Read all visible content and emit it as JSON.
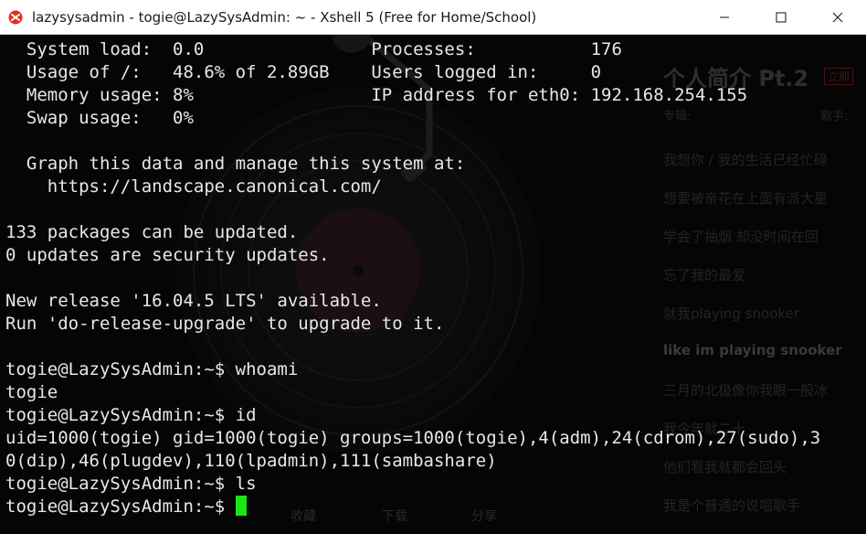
{
  "window": {
    "title": "lazysysadmin - togie@LazySysAdmin: ~ - Xshell 5 (Free for Home/School)",
    "controls": [
      "minimize-icon",
      "maximize-icon",
      "close-icon"
    ]
  },
  "terminal": {
    "lines": [
      "  System load:  0.0                Processes:           176",
      "  Usage of /:   48.6% of 2.89GB    Users logged in:     0",
      "  Memory usage: 8%                 IP address for eth0: 192.168.254.155",
      "  Swap usage:   0%",
      "",
      "  Graph this data and manage this system at:",
      "    https://landscape.canonical.com/",
      "",
      "133 packages can be updated.",
      "0 updates are security updates.",
      "",
      "New release '16.04.5 LTS' available.",
      "Run 'do-release-upgrade' to upgrade to it.",
      "",
      "togie@LazySysAdmin:~$ whoami",
      "togie",
      "togie@LazySysAdmin:~$ id",
      "uid=1000(togie) gid=1000(togie) groups=1000(togie),4(adm),24(cdrom),27(sudo),3",
      "0(dip),46(plugdev),110(lpadmin),111(sambashare)",
      "togie@LazySysAdmin:~$ ls",
      "togie@LazySysAdmin:~$ "
    ],
    "cursor_color": "#19e619",
    "text_color": "#e8e8e8",
    "background_color": "#050505"
  },
  "wallpaper": {
    "title": "个人简介 Pt.2",
    "tag": "立即",
    "meta_left": "专辑:",
    "meta_right": "歌手:",
    "lyrics": [
      "我想你 / 我的生活已经忙碌",
      "想要被亲花在上面有派大星",
      "学会了抽烟 却没时间在回",
      "忘了我的最爱",
      "就我playing snooker",
      "like im playing snooker",
      "三月的北极像你我眼一般冰",
      "我今年就二十",
      "他们看我就都会回头",
      "我是个普通的说唱歌手"
    ],
    "highlight_index": 5,
    "actions": [
      "收藏",
      "下载",
      "分享"
    ]
  }
}
